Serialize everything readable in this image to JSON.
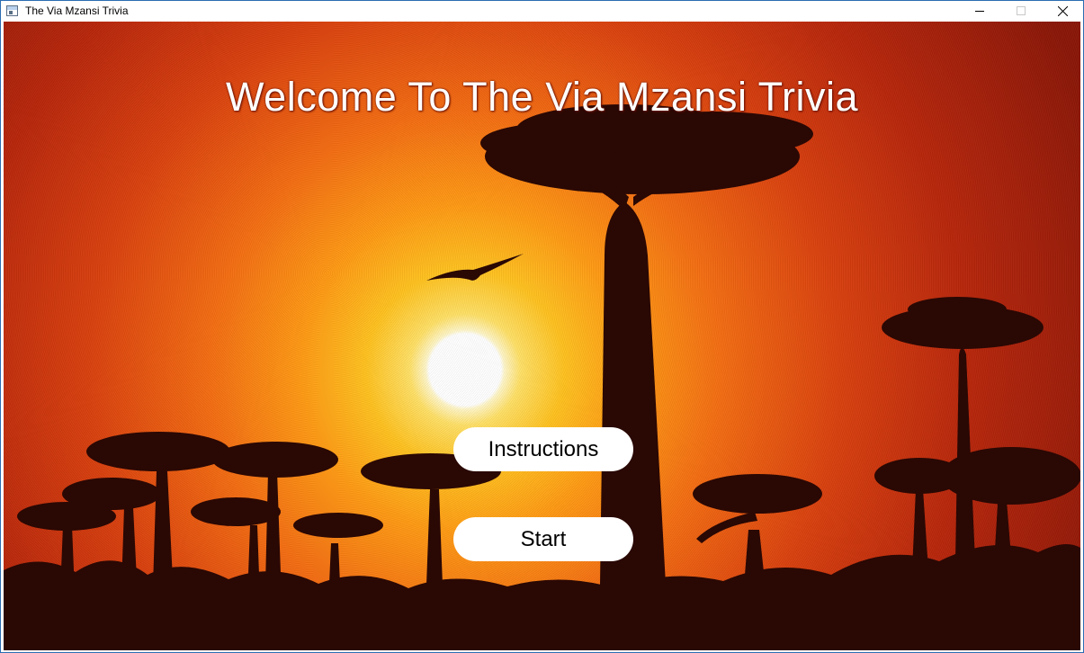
{
  "window": {
    "title": "The Via Mzansi Trivia",
    "app_icon": "window-app-icon",
    "controls": {
      "minimize_icon": "minimize-icon",
      "maximize_icon": "maximize-icon",
      "close_icon": "close-icon",
      "maximize_enabled": false
    }
  },
  "main": {
    "heading": "Welcome To The Via Mzansi Trivia",
    "buttons": {
      "instructions_label": "Instructions",
      "start_label": "Start"
    },
    "background": {
      "description_icon": "baobab-sunset-image",
      "sky_colors": [
        "#ffffff",
        "#ffe066",
        "#ff9b14",
        "#d9400e",
        "#8a1607"
      ],
      "silhouette_color": "#2a0804"
    }
  }
}
